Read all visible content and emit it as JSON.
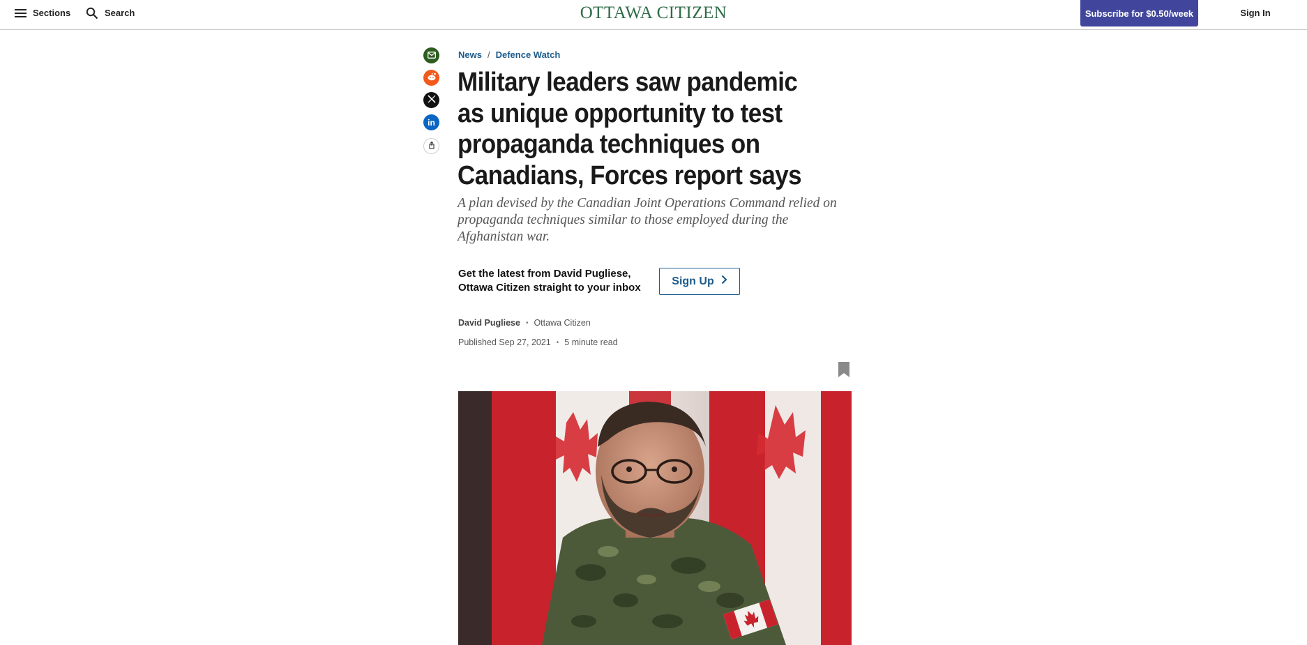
{
  "header": {
    "sections_label": "Sections",
    "search_label": "Search",
    "logo_text": "OTTAWA CITIZEN",
    "subscribe_label": "Subscribe for $0.50/week",
    "signin_label": "Sign In"
  },
  "share": {
    "items": [
      "email-icon",
      "reddit-icon",
      "x-icon",
      "linkedin-icon",
      "share-icon"
    ]
  },
  "article": {
    "breadcrumbs": [
      "News",
      "Defence Watch"
    ],
    "breadcrumb_separator": "/",
    "headline": "Military leaders saw pandemic as unique opportunity to test propaganda techniques on Canadians, Forces report says",
    "deck": "A plan devised by the Canadian Joint Operations Command relied on propaganda techniques similar to those employed during the Afghanistan war.",
    "promo_text": "Get the latest from David Pugliese, Ottawa Citizen straight to your inbox",
    "signup_label": "Sign Up",
    "author": "David Pugliese",
    "outlet": "Ottawa Citizen",
    "published": "Published Sep 27, 2021",
    "read_time": "5 minute read",
    "byline_separator": "•"
  },
  "colors": {
    "brand_green": "#2f6b46",
    "subscribe_bg": "#41469c",
    "link_blue": "#1c5b8b"
  }
}
